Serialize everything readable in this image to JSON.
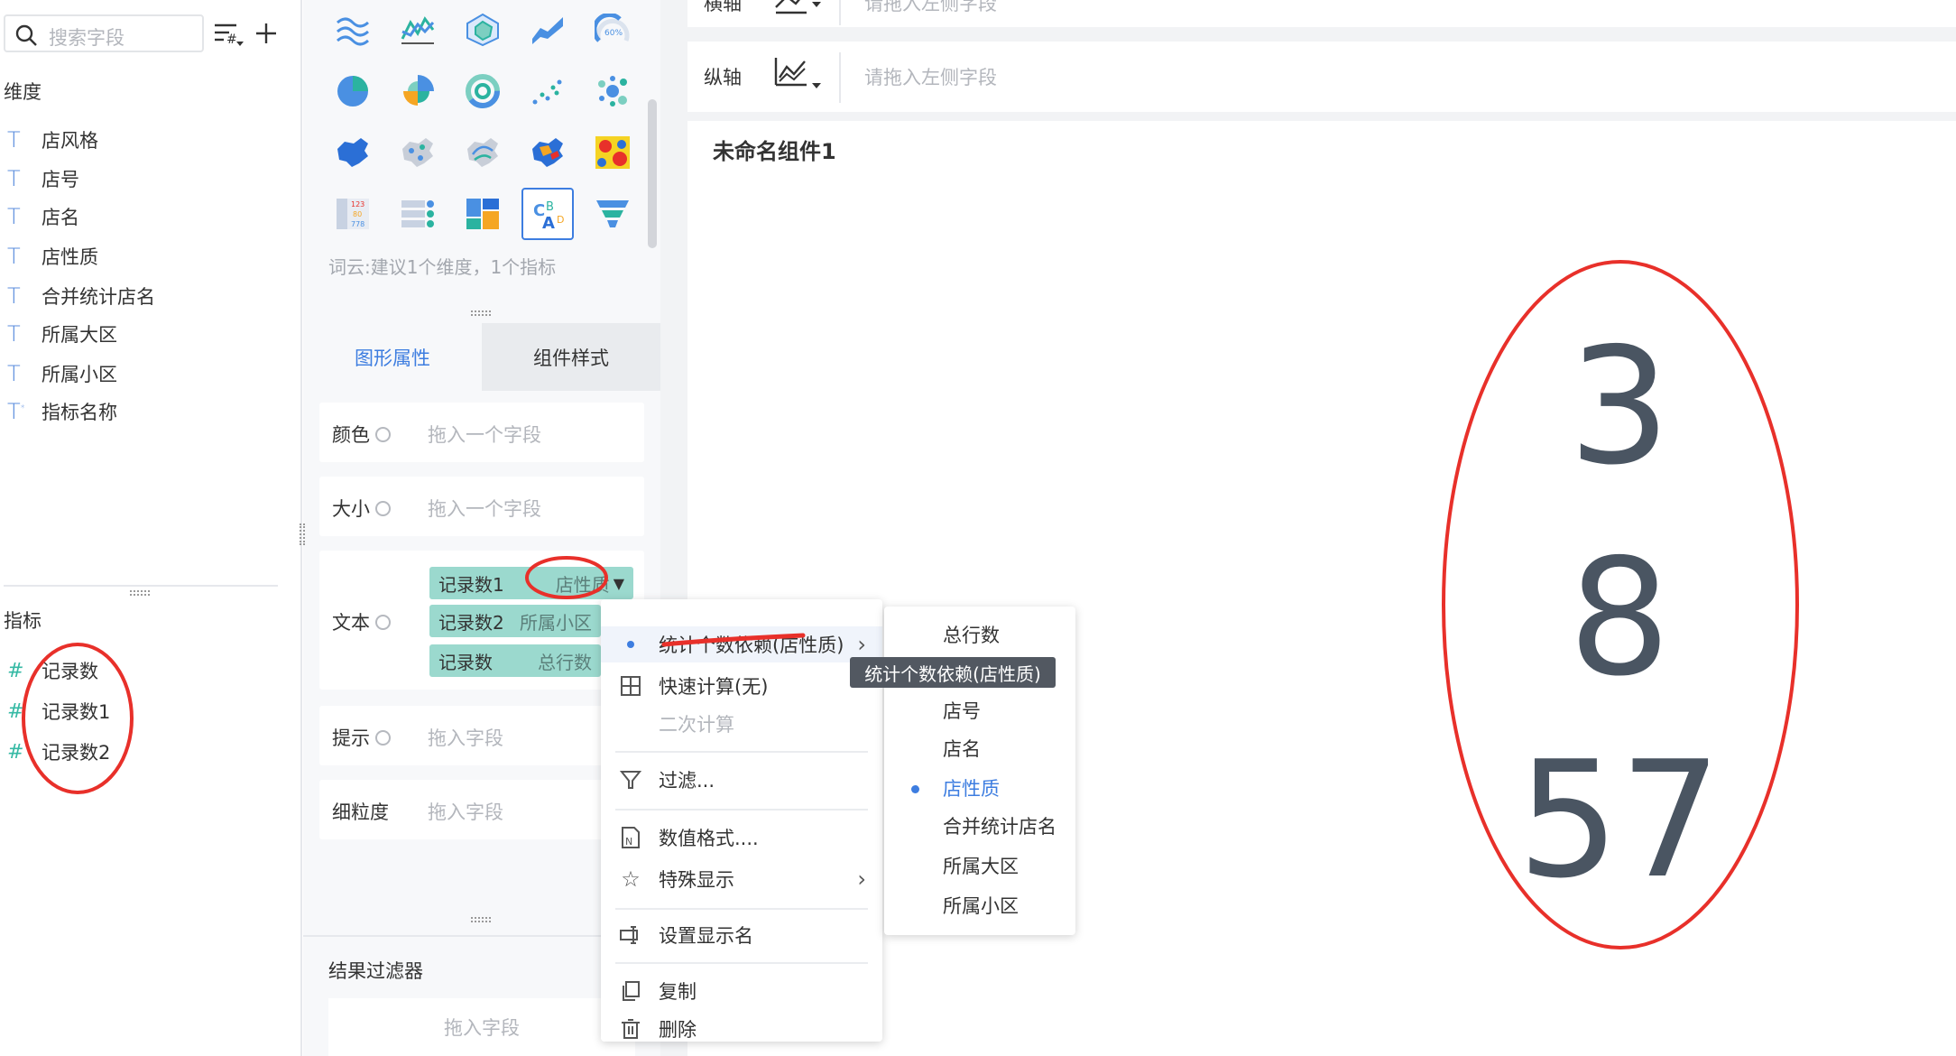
{
  "left_panel": {
    "search_placeholder": "搜索字段",
    "dimension_title": "维度",
    "dimensions": [
      "店风格",
      "店号",
      "店名",
      "店性质",
      "合并统计店名",
      "所属大区",
      "所属小区",
      "指标名称"
    ],
    "measure_title": "指标",
    "measures": [
      "记录数",
      "记录数1",
      "记录数2"
    ]
  },
  "chart_panel": {
    "hint": "词云:建议1个维度，1个指标",
    "tabs": [
      "图形属性",
      "组件样式"
    ],
    "color_label": "颜色",
    "size_label": "大小",
    "text_label": "文本",
    "tooltip_label": "提示",
    "granularity_label": "细粒度",
    "drag_one_field": "拖入一个字段",
    "drag_field": "拖入字段",
    "text_pills": [
      {
        "name": "记录数1",
        "desc": "店性质"
      },
      {
        "name": "记录数2",
        "desc": "所属小区"
      },
      {
        "name": "记录数",
        "desc": "总行数"
      }
    ],
    "result_filter_title": "结果过滤器",
    "result_filter_placeholder": "拖入字段"
  },
  "axes": {
    "x_label": "横轴",
    "y_label": "纵轴",
    "placeholder": "请拖入左侧字段"
  },
  "canvas": {
    "title": "未命名组件1",
    "words": [
      "3",
      "8",
      "57"
    ]
  },
  "context_menu": {
    "items": [
      "统计个数依赖(店性质)",
      "快速计算(无)",
      "二次计算",
      "过滤...",
      "数值格式....",
      "特殊显示",
      "设置显示名",
      "复制",
      "删除"
    ]
  },
  "submenu": {
    "items": [
      "总行数",
      "店号",
      "店名",
      "店性质",
      "合并统计店名",
      "所属大区",
      "所属小区"
    ],
    "selected": "店性质"
  },
  "tooltip": "统计个数依赖(店性质)",
  "colors": {
    "accent": "#3d7de0",
    "pill": "#9bd9ce",
    "annotation": "#e8302a",
    "word": "#4a5562"
  }
}
